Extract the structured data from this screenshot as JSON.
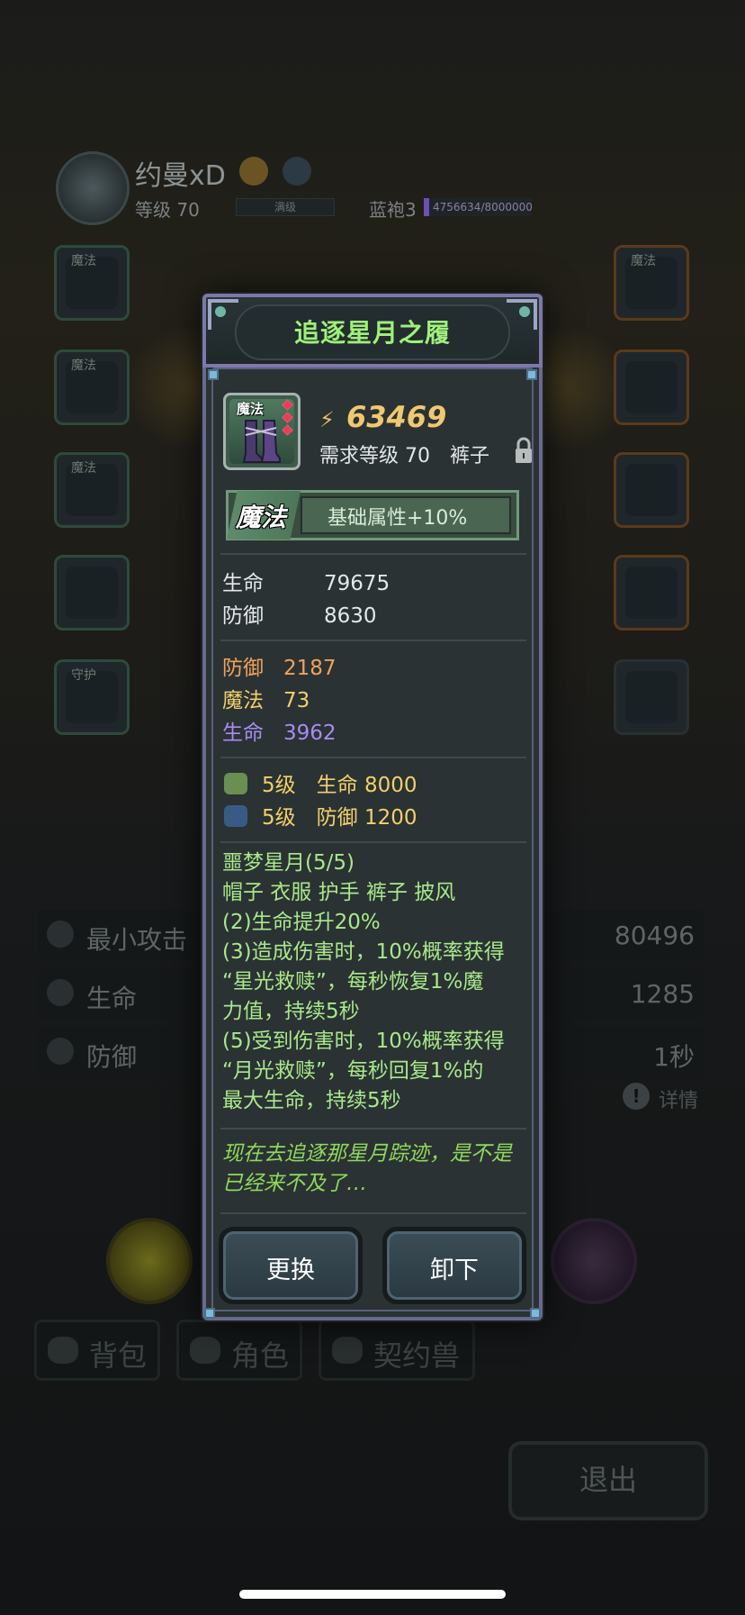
{
  "background": {
    "player_name": "约曼xD",
    "level_label": "等级 70",
    "level_bar_text": "满级",
    "robe_label": "蓝袍3",
    "exp_text": "4756634/8000000",
    "slot_tags_left": [
      "魔法",
      "魔法",
      "魔法",
      "",
      "守护"
    ],
    "slot_tags_right": [
      "魔法",
      "",
      "",
      "",
      ""
    ],
    "stats": [
      {
        "label": "最小攻击",
        "value": "80496"
      },
      {
        "label": "生命",
        "value": "1285"
      },
      {
        "label": "防御",
        "value": "1秒"
      }
    ],
    "detail_label": "详情",
    "tabs": [
      "背包",
      "角色",
      "契约兽"
    ],
    "exit_label": "退出"
  },
  "modal": {
    "title": "追逐星月之履",
    "item_tag": "魔法",
    "power": "63469",
    "requirement": "需求等级 70　裤子",
    "quality_label": "魔法",
    "quality_text": "基础属性+10%",
    "base_stats": [
      {
        "label": "生命",
        "value": "79675"
      },
      {
        "label": "防御",
        "value": "8630"
      }
    ],
    "bonus_stats": [
      {
        "label": "防御",
        "value": "2187",
        "color": "#f0a25a"
      },
      {
        "label": "魔法",
        "value": "73",
        "color": "#f2d06b"
      },
      {
        "label": "生命",
        "value": "3962",
        "color": "#a88cf0"
      }
    ],
    "gems": [
      {
        "text": "5级　生命 8000",
        "icon": "green-gem-icon"
      },
      {
        "text": "5级　防御 1200",
        "icon": "blue-gem-icon"
      }
    ],
    "set_lines": [
      "噩梦星月(5/5)",
      "帽子 衣服 护手 裤子 披风",
      "(2)生命提升20%",
      "(3)造成伤害时，10%概率获得",
      "“星光救赎”，每秒恢复1%魔",
      "力值，持续5秒",
      "(5)受到伤害时，10%概率获得",
      "“月光救赎”，每秒回复1%的",
      "最大生命，持续5秒"
    ],
    "flavor_lines": [
      "现在去追逐那星月踪迹，是不是",
      "已经来不及了…"
    ],
    "buttons": {
      "replace": "更换",
      "unequip": "卸下"
    }
  },
  "colors": {
    "title_green": "#9ef07a",
    "set_green": "#a9e88a",
    "flavor_green": "#8fd85a",
    "power_gold": "#f0c870"
  }
}
